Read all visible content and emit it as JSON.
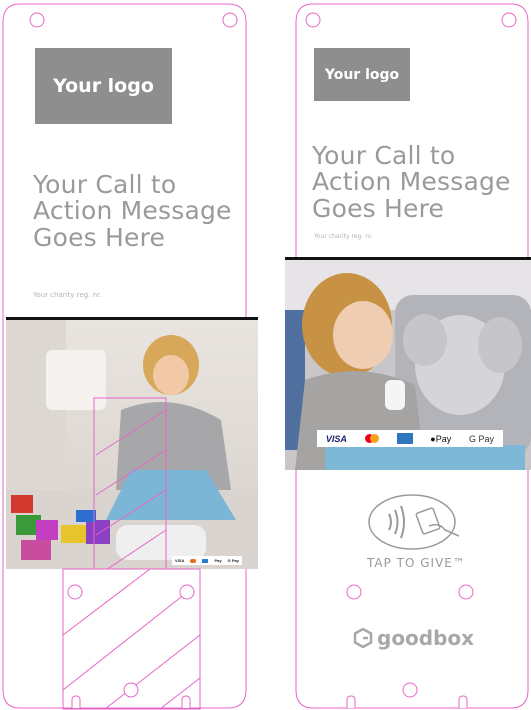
{
  "left": {
    "logo": "Your logo",
    "cta": [
      "Your Call to",
      "Action Message",
      "Goes Here"
    ],
    "reg": "Your charity reg. nr.",
    "payments": [
      "VISA",
      "mc",
      "AMEX",
      "Pay",
      "G Pay"
    ]
  },
  "right": {
    "logo": "Your logo",
    "cta": [
      "Your Call to",
      "Action Message",
      "Goes Here"
    ],
    "reg": "Your charity reg. nr.",
    "payments": {
      "visa": "VISA",
      "apple": "Pay",
      "google": "G Pay"
    },
    "tap_label": "TAP TO GIVE™",
    "brand": "goodbox"
  },
  "colors": {
    "outline": "#e766c8",
    "logo_bg": "#8e8e8e",
    "text_grey": "#9a9a9a",
    "separator": "#111111"
  },
  "icons": [
    "contactless-card-icon",
    "goodbox-logo-icon"
  ]
}
